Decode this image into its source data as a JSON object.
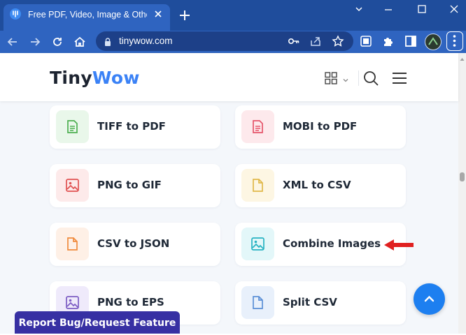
{
  "browser": {
    "tab_title": "Free PDF, Video, Image & Other O",
    "url": "tinywow.com",
    "icons": [
      "tab-favicon-icon",
      "tab-close-icon",
      "new-tab-icon",
      "minimize-icon",
      "maximize-icon",
      "window-close-icon",
      "chevron-down-icon",
      "back-icon",
      "forward-icon",
      "reload-icon",
      "home-icon",
      "lock-icon",
      "key-icon",
      "share-icon",
      "star-icon",
      "extension-icon",
      "puzzle-icon",
      "sidebar-icon",
      "profile-avatar",
      "menu-dots-icon"
    ]
  },
  "site": {
    "logo_part1": "Tiny",
    "logo_part2": "Wow",
    "header_icons": [
      "grid-icon",
      "chevron-down-icon",
      "search-icon",
      "hamburger-icon"
    ],
    "colors": {
      "logo_dark": "#1c2330",
      "logo_blue": "#3b82f6",
      "report_button": "#3730a3",
      "scroll_top": "#1d7ff0",
      "annotation_arrow": "#e02020"
    }
  },
  "tools": [
    {
      "label": "TIFF to PDF",
      "icon": "document-icon",
      "color": "#4caf50",
      "bg": "#e9f7ea"
    },
    {
      "label": "MOBI to PDF",
      "icon": "document-icon",
      "color": "#e5546a",
      "bg": "#fde9ec"
    },
    {
      "label": "PNG to GIF",
      "icon": "image-icon",
      "color": "#e05252",
      "bg": "#fdeaea"
    },
    {
      "label": "XML to CSV",
      "icon": "file-icon",
      "color": "#e0b84a",
      "bg": "#fdf6e3"
    },
    {
      "label": "CSV to JSON",
      "icon": "file-icon",
      "color": "#f08a3c",
      "bg": "#fef0e6"
    },
    {
      "label": "Combine Images",
      "icon": "image-icon",
      "color": "#27b3c2",
      "bg": "#e3f7f9"
    },
    {
      "label": "PNG to EPS",
      "icon": "image-icon",
      "color": "#7c5cc4",
      "bg": "#efeafb"
    },
    {
      "label": "Split CSV",
      "icon": "file-icon",
      "color": "#5b8fd6",
      "bg": "#e8f0fb"
    }
  ],
  "report_button": "Report Bug/Request Feature",
  "scroll_top_icon": "chevron-up-icon",
  "annotation": "red-arrow-pointer"
}
